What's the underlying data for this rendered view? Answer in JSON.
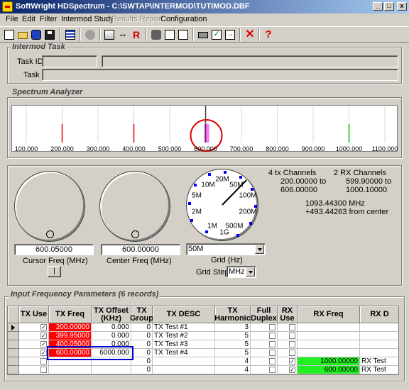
{
  "window": {
    "title": "SoftWright HDSpectrum - C:\\SWTAP\\INTERMOD\\TUTIMOD.DBF",
    "minimize": "_",
    "maximize": "□",
    "close": "x"
  },
  "menu": {
    "file": "File",
    "edit": "Edit",
    "filter": "Filter",
    "intermod_study": "Intermod Study",
    "results_report": "Results Report",
    "configuration": "Configuration"
  },
  "intermod_task": {
    "title": "Intermod Task",
    "task_id_label": "Task ID:",
    "task_id_value": "",
    "task_id_desc": "",
    "task_label": "Task",
    "task_value": ""
  },
  "spectrum": {
    "title": "Spectrum Analyzer",
    "ticks": [
      "100.000",
      "200.000",
      "300.000",
      "400.000",
      "500.000",
      "600.000",
      "700.000",
      "800.000",
      "900.000",
      "1000.000",
      "1100.000"
    ],
    "markers": [
      {
        "freq": 200.0,
        "color": "#e00000"
      },
      {
        "freq": 400.05,
        "color": "#e00000"
      },
      {
        "freq": 1000.0,
        "color": "#00c000"
      }
    ],
    "cursor_freq_line": 600.05,
    "highlight": {
      "from": 599.9,
      "to": 606.0,
      "color": "#ff00ff"
    },
    "annotation_color": "#e00000"
  },
  "controls": {
    "cursor_freq_value": "600.05000",
    "cursor_freq_label": "Cursor Freq (MHz)",
    "center_freq_value": "600.00000",
    "center_freq_label": "Center Freq (MHz)",
    "step_button": "|",
    "grid_value": "50M",
    "grid_label": "Grid (Hz)",
    "grid_step_label": "Grid Step",
    "grid_step_value": "MHz",
    "dial_labels": [
      "1M",
      "2M",
      "5M",
      "10M",
      "20M",
      "50M",
      "100M",
      "200M",
      "500M",
      "1G"
    ]
  },
  "info": {
    "tx_channels": "4 tx Channels",
    "tx_range_1": "200.00000 to",
    "tx_range_2": "606.00000",
    "rx_channels": "2 RX Channels",
    "rx_range_1": "599.90000 to",
    "rx_range_2": "1000.10000",
    "center_mhz": "1093.44300 MHz",
    "from_center": "+493.44263 from center"
  },
  "table": {
    "title": "Input Frequency Parameters (6 records)",
    "headers": [
      "TX Use",
      "TX Freq",
      "TX Offset\n(KHz)",
      "TX\nGroup",
      "TX DESC",
      "TX\nHarmonic",
      "Full\nDuplex",
      "RX\nUse",
      "RX Freq",
      "RX D"
    ],
    "rows": [
      {
        "tx_use": true,
        "tx_freq": "200.00000",
        "tx_offset": "0.000",
        "tx_group": "0",
        "tx_desc": "TX Test #1",
        "tx_harmonic": "3",
        "full_duplex": false,
        "rx_use": false,
        "rx_freq": "",
        "rx_desc": "",
        "current": true
      },
      {
        "tx_use": true,
        "tx_freq": "399.95000",
        "tx_offset": "0.000",
        "tx_group": "0",
        "tx_desc": "TX Test #2",
        "tx_harmonic": "5",
        "full_duplex": false,
        "rx_use": false,
        "rx_freq": "",
        "rx_desc": "",
        "current": false
      },
      {
        "tx_use": true,
        "tx_freq": "400.05000",
        "tx_offset": "0.000",
        "tx_group": "0",
        "tx_desc": "TX Test #3",
        "tx_harmonic": "5",
        "full_duplex": false,
        "rx_use": false,
        "rx_freq": "",
        "rx_desc": "",
        "current": false
      },
      {
        "tx_use": true,
        "tx_freq": "600.00000",
        "tx_offset": "6000.000",
        "tx_group": "0",
        "tx_desc": "TX Test #4",
        "tx_harmonic": "5",
        "full_duplex": false,
        "rx_use": false,
        "rx_freq": "",
        "rx_desc": "",
        "current": false
      },
      {
        "tx_use": false,
        "tx_freq": "",
        "tx_offset": "",
        "tx_group": "0",
        "tx_desc": "",
        "tx_harmonic": "4",
        "full_duplex": false,
        "rx_use": true,
        "rx_freq": "1000.00000",
        "rx_desc": "RX Test",
        "current": false
      },
      {
        "tx_use": false,
        "tx_freq": "",
        "tx_offset": "",
        "tx_group": "0",
        "tx_desc": "",
        "tx_harmonic": "4",
        "full_duplex": false,
        "rx_use": true,
        "rx_freq": "600.00000",
        "rx_desc": "RX Test",
        "current": false
      }
    ],
    "tx_freq_highlight": "#ff0000",
    "rx_freq_highlight": "#22ee22",
    "selection_box_color": "#0000cc"
  }
}
